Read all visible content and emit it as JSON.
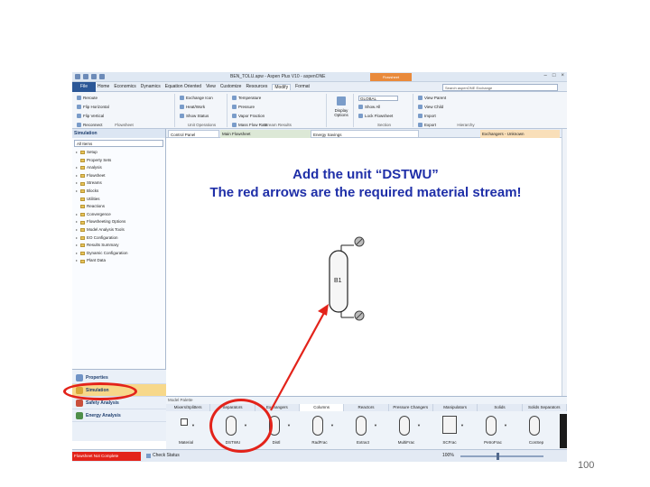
{
  "app": {
    "title": "BEN_TOLU.apw - Aspen Plus V10 - aspenONE",
    "context_tab": "Flowsheet",
    "tabs": [
      "File",
      "Home",
      "Economics",
      "Dynamics",
      "Equation Oriented",
      "View",
      "Customize",
      "Resources",
      "Modify",
      "Format"
    ],
    "active_tab": "Modify",
    "search_placeholder": "Search aspenONE Exchange"
  },
  "ribbon": {
    "flowsheet": {
      "name": "Flowsheet",
      "items": [
        "Reroute",
        "Reconnect",
        "Join",
        "Flip Horizontal",
        "Break",
        "Reroute Stream",
        "Flip Vertical",
        "Insert",
        "Align"
      ]
    },
    "unit_operations": {
      "name": "Unit Operations",
      "items": [
        "Exchange Icon",
        "Heat/Work",
        "Show Status"
      ]
    },
    "stream_results": {
      "name": "Stream Results",
      "items": [
        "Temperature",
        "Mass Flow Rate",
        "Pressure",
        "Mole Flow Rate",
        "Vapor Fraction",
        "Volume Flow Rate"
      ]
    },
    "display": {
      "name": "Display Options"
    },
    "section": {
      "name": "Section",
      "items": [
        "GLOBAL",
        "Show All",
        "Lock Flowsheet"
      ]
    },
    "hierarchy": {
      "name": "Hierarchy",
      "items": [
        "View Parent",
        "Export",
        "View Child",
        "Move Selection",
        "Import"
      ]
    }
  },
  "sidebar": {
    "header": "Simulation",
    "filter": "All Items",
    "tree": [
      "Setup",
      "Property Sets",
      "Analysis",
      "Flowsheet",
      "Streams",
      "Blocks",
      "Utilities",
      "Reactions",
      "Convergence",
      "Flowsheeting Options",
      "Model Analysis Tools",
      "EO Configuration",
      "Results Summary",
      "Dynamic Configuration",
      "Plant Data"
    ],
    "nav": [
      "Properties",
      "Simulation",
      "Safety Analysis",
      "Energy Analysis"
    ],
    "active_nav": "Simulation"
  },
  "canvas": {
    "tabs": [
      "Control Panel",
      "Main Flowsheet",
      "Energy Savings",
      "Exchangers - Unknown"
    ],
    "block_label": "B1",
    "annotation_line1": "Add the unit “DSTWU”",
    "annotation_line2": "The red arrows are the required material stream!"
  },
  "palette": {
    "title": "Model Palette",
    "tabs": [
      "Mixers/Splitters",
      "Separators",
      "Exchangers",
      "Columns",
      "Reactors",
      "Pressure Changers",
      "Manipulators",
      "Solids",
      "Solids Separators"
    ],
    "active_tab": "Columns",
    "blocks": [
      "Material",
      "DSTWU",
      "Distl",
      "RadFrac",
      "Extract",
      "MultiFrac",
      "SCFrac",
      "PetroFrac",
      "ConSep"
    ]
  },
  "status": {
    "error": "Flowsheet Not Complete",
    "check": "Check Status",
    "zoom": "100%"
  },
  "page_number": "100",
  "colors": {
    "highlight_red": "#e3231a",
    "annotation_blue": "#1f2fa8",
    "ribbon_blue": "#2b5797"
  }
}
